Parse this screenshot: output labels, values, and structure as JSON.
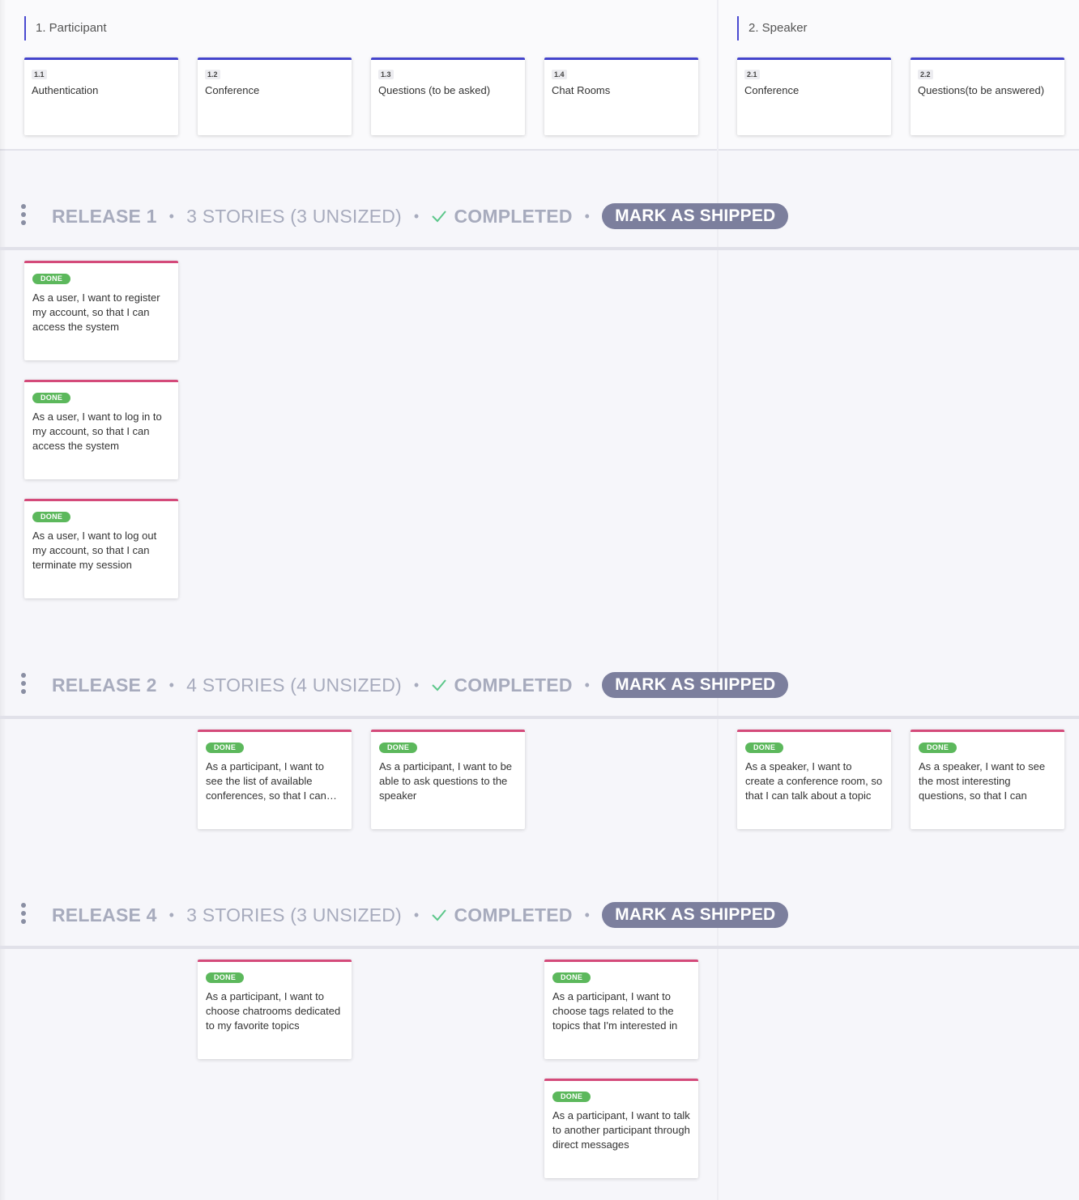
{
  "activities": [
    {
      "label": "1. Participant"
    },
    {
      "label": "2. Speaker"
    }
  ],
  "features": [
    {
      "num": "1.1",
      "title": "Authentication"
    },
    {
      "num": "1.2",
      "title": "Conference"
    },
    {
      "num": "1.3",
      "title": "Questions (to be asked)"
    },
    {
      "num": "1.4",
      "title": "Chat Rooms"
    },
    {
      "num": "2.1",
      "title": "Conference"
    },
    {
      "num": "2.2",
      "title": "Questions(to be answered)"
    }
  ],
  "releases": [
    {
      "name": "RELEASE 1",
      "stories": "3 STORIES (3 UNSIZED)",
      "status": "COMPLETED",
      "action": "MARK AS SHIPPED"
    },
    {
      "name": "RELEASE 2",
      "stories": "4 STORIES (4 UNSIZED)",
      "status": "COMPLETED",
      "action": "MARK AS SHIPPED"
    },
    {
      "name": "RELEASE 4",
      "stories": "3 STORIES (3 UNSIZED)",
      "status": "COMPLETED",
      "action": "MARK AS SHIPPED"
    }
  ],
  "separator": "•",
  "stories": {
    "r1": [
      {
        "badge": "DONE",
        "text": "As a user, I want to register my account, so that I can access the system"
      },
      {
        "badge": "DONE",
        "text": "As a user, I want to log in to my account, so that I can access the system"
      },
      {
        "badge": "DONE",
        "text": "As a user, I want to log out my account, so that I can terminate my session"
      }
    ],
    "r2": [
      {
        "badge": "DONE",
        "text": "As a participant, I want to see the list of available conferences, so that I can… choose one"
      },
      {
        "badge": "DONE",
        "text": "As a participant, I want to be able to ask questions to the speaker"
      },
      {
        "badge": "DONE",
        "text": "As a speaker, I want to create a conference room, so that I can talk about a topic"
      },
      {
        "badge": "DONE",
        "text": "As a speaker, I want to see the most interesting questions, so that I can answer it"
      }
    ],
    "r4": [
      {
        "badge": "DONE",
        "text": "As a participant, I want to choose chatrooms dedicated to my favorite topics"
      },
      {
        "badge": "DONE",
        "text": "As a participant, I want to choose tags related to the topics that I'm interested in"
      },
      {
        "badge": "DONE",
        "text": "As a participant, I want to talk to another participant through direct messages"
      }
    ]
  },
  "colors": {
    "feature_accent": "#4444cc",
    "story_accent": "#d44a7a",
    "done_badge": "#5cb85c",
    "ship_button": "#7c7f9d",
    "completed_check": "#5cc78a"
  }
}
